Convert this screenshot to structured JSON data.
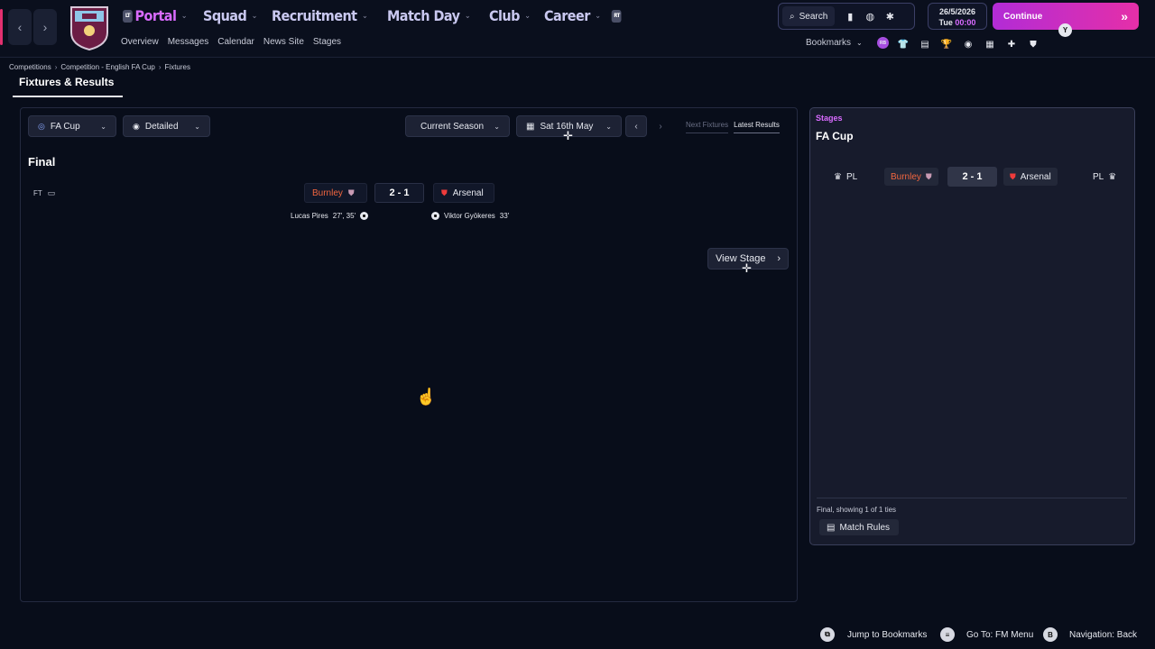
{
  "topbar": {
    "nav_back": "‹",
    "nav_forward": "›",
    "main_nav": [
      {
        "label": "Portal",
        "active": true,
        "badge": "LT"
      },
      {
        "label": "Squad"
      },
      {
        "label": "Recruitment"
      },
      {
        "label": "Match Day"
      },
      {
        "label": "Club"
      },
      {
        "label": "Career",
        "extra_badge": "RT"
      }
    ],
    "sub_nav": [
      "Overview",
      "Messages",
      "Calendar",
      "News Site",
      "Stages"
    ],
    "search_label": "Search",
    "date": "26/5/2026",
    "day": "Tue",
    "time": "00:00",
    "continue_label": "Continue",
    "continue_badge": "Y",
    "bookmarks_label": "Bookmarks",
    "bookmarks_badge": "RB"
  },
  "breadcrumb": [
    "Competitions",
    "Competition - English FA Cup",
    "Fixtures"
  ],
  "page_title": "Fixtures & Results",
  "filters": {
    "competition": "FA Cup",
    "view": "Detailed",
    "season": "Current Season",
    "date": "Sat 16th May",
    "tab_next": "Next Fixtures",
    "tab_latest": "Latest Results"
  },
  "stage_header": "Final",
  "fixture": {
    "status": "FT",
    "home_team": "Burnley",
    "score": "2 - 1",
    "away_team": "Arsenal",
    "home_scorers": "Lucas Pires",
    "home_minutes": "27', 35'",
    "away_scorers": "Viktor Gyökeres",
    "away_minutes": "33'"
  },
  "view_stage_label": "View Stage",
  "side_panel": {
    "header": "Stages",
    "competition": "FA Cup",
    "home_league": "PL",
    "home_team": "Burnley",
    "score": "2 - 1",
    "away_team": "Arsenal",
    "away_league": "PL",
    "footer": "Final, showing 1 of 1 ties",
    "match_rules": "Match Rules"
  },
  "bottom_bar": {
    "bookmarks_hint": "Jump to Bookmarks",
    "menu_hint": "Go To: FM Menu",
    "back_key": "B",
    "back_hint": "Navigation: Back"
  },
  "colors": {
    "accent": "#d96bff",
    "home_team": "#f2663f",
    "continue_start": "#b22cd6",
    "continue_end": "#e52fa8",
    "background": "#080d1a"
  }
}
